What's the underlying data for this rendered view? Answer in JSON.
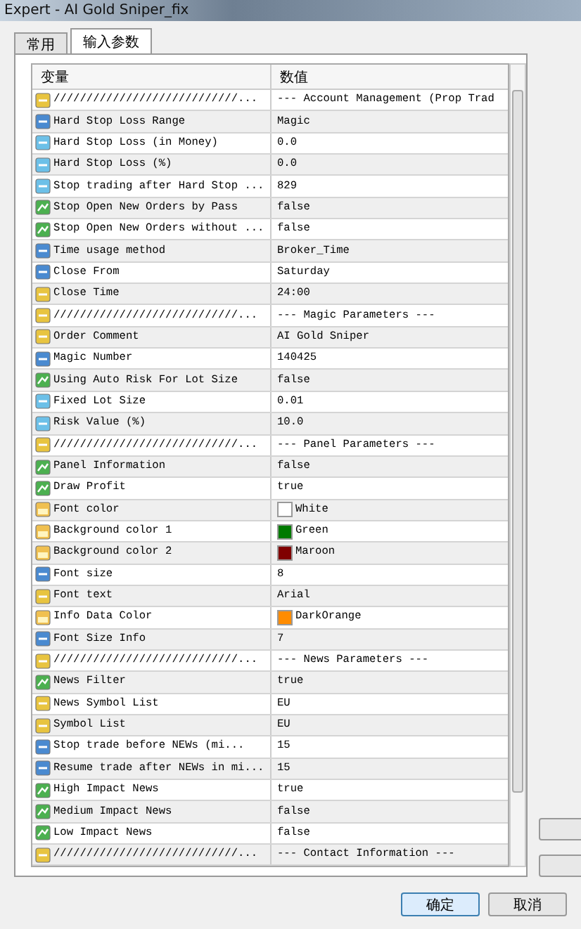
{
  "window": {
    "title": "Expert - AI Gold Sniper_fix"
  },
  "tabs": [
    {
      "label": "常用",
      "selected": false
    },
    {
      "label": "输入参数",
      "selected": true
    }
  ],
  "table": {
    "columns": [
      "变量",
      "数值"
    ],
    "rows": [
      {
        "kind": "string",
        "name": "////////////////////////////...",
        "value": "--- Account Management (Prop Trad"
      },
      {
        "kind": "int",
        "name": "Hard Stop Loss Range",
        "value": "Magic"
      },
      {
        "kind": "double",
        "name": "Hard Stop Loss (in Money)",
        "value": "0.0"
      },
      {
        "kind": "double",
        "name": "Hard Stop Loss (%)",
        "value": "0.0"
      },
      {
        "kind": "double",
        "name": "Stop trading after Hard Stop ...",
        "value": "829"
      },
      {
        "kind": "bool",
        "name": "Stop Open New Orders by Pass",
        "value": "false"
      },
      {
        "kind": "bool",
        "name": "Stop Open New Orders without ...",
        "value": "false"
      },
      {
        "kind": "int",
        "name": "Time usage method",
        "value": "Broker_Time"
      },
      {
        "kind": "int",
        "name": "Close From",
        "value": "Saturday"
      },
      {
        "kind": "string",
        "name": "Close Time",
        "value": "24:00"
      },
      {
        "kind": "string",
        "name": "////////////////////////////...",
        "value": "--- Magic Parameters ---"
      },
      {
        "kind": "string",
        "name": "Order Comment",
        "value": "AI Gold Sniper"
      },
      {
        "kind": "int",
        "name": "Magic Number",
        "value": "140425"
      },
      {
        "kind": "bool",
        "name": "Using Auto Risk For Lot Size",
        "value": "false"
      },
      {
        "kind": "double",
        "name": "Fixed Lot Size",
        "value": "0.01"
      },
      {
        "kind": "double",
        "name": "Risk Value (%)",
        "value": "10.0"
      },
      {
        "kind": "string",
        "name": "////////////////////////////...",
        "value": "--- Panel Parameters ---"
      },
      {
        "kind": "bool",
        "name": "Panel Information",
        "value": "false"
      },
      {
        "kind": "bool",
        "name": "Draw Profit",
        "value": "true"
      },
      {
        "kind": "color",
        "name": "Font color",
        "value": "White",
        "color": "#ffffff"
      },
      {
        "kind": "color",
        "name": "Background color 1",
        "value": "Green",
        "color": "#007a00"
      },
      {
        "kind": "color",
        "name": "Background color 2",
        "value": "Maroon",
        "color": "#800000"
      },
      {
        "kind": "int",
        "name": "Font size",
        "value": "8"
      },
      {
        "kind": "string",
        "name": "Font text",
        "value": "Arial"
      },
      {
        "kind": "color",
        "name": "Info Data Color",
        "value": "DarkOrange",
        "color": "#ff8c00"
      },
      {
        "kind": "int",
        "name": "Font Size Info",
        "value": "7"
      },
      {
        "kind": "string",
        "name": "////////////////////////////...",
        "value": "--- News Parameters ---"
      },
      {
        "kind": "bool",
        "name": "News Filter",
        "value": "true"
      },
      {
        "kind": "string",
        "name": "News Symbol List",
        "value": "EU"
      },
      {
        "kind": "string",
        "name": "Symbol List",
        "value": "EU"
      },
      {
        "kind": "int",
        "name": "Stop trade before NEWs (mi...",
        "value": "15"
      },
      {
        "kind": "int",
        "name": "Resume trade after NEWs in mi...",
        "value": "15"
      },
      {
        "kind": "bool",
        "name": "High Impact News",
        "value": "true"
      },
      {
        "kind": "bool",
        "name": "Medium Impact News",
        "value": "false"
      },
      {
        "kind": "bool",
        "name": "Low Impact News",
        "value": "false"
      },
      {
        "kind": "string",
        "name": "////////////////////////////...",
        "value": "--- Contact Information ---"
      }
    ]
  },
  "buttons": [
    {
      "label": "确定",
      "selected": true
    },
    {
      "label": "取消",
      "selected": false
    }
  ]
}
